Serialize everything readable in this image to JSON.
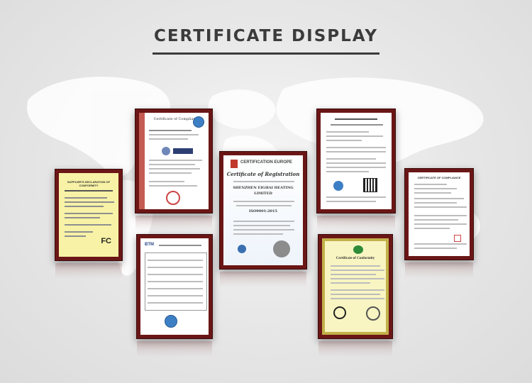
{
  "page": {
    "headline": "CERTIFICATE DISPLAY"
  },
  "certificates": {
    "supplier_declaration": {
      "title": "SUPPLIER'S DECLARATION OF CONFORMITY",
      "mark": "FC"
    },
    "ce_compliance": {
      "title": "Certificate of Compliance"
    },
    "iso_registration": {
      "header": "CERTIFICATION EUROPE",
      "title": "Certificate of Registration",
      "company": "SHENZHEN EIGHAI HEATING LIMITED",
      "standard": "ISO9001:2015"
    },
    "test_report": {
      "logo": "BTM"
    },
    "chinese_report": {},
    "conformity": {
      "title": "Certificate of Conformity"
    },
    "compliance_right": {
      "title": "CERTIFICATE OF COMPLIANCE"
    }
  },
  "colors": {
    "frame": "#6b1616",
    "yellow_paper": "#f7f2a6",
    "ce_red": "#c45b52",
    "iso_blue": "#3a6fb0",
    "seal_blue": "#3d7fc4",
    "seal_green": "#2f8a3a",
    "headline": "#3b3b3b"
  }
}
